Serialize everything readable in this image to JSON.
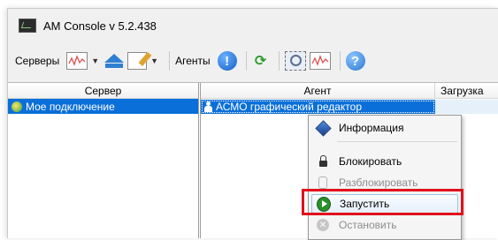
{
  "window": {
    "title": "AM Console v  5.2.438"
  },
  "toolbar": {
    "servers_label": "Серверы",
    "agents_label": "Агенты",
    "icons": [
      "monitor-chart-icon",
      "upload-arrow-icon",
      "edit-icon",
      "info-icon",
      "refresh-icon",
      "scan-icon",
      "monitor-chart-icon",
      "help-icon"
    ]
  },
  "left_pane": {
    "header": "Сервер",
    "rows": [
      {
        "label": "Мое подключение"
      }
    ]
  },
  "right_pane": {
    "headers": {
      "agent": "Агент",
      "load": "Загрузка"
    },
    "rows": [
      {
        "agent": "АСМО графический редактор",
        "load": ""
      }
    ]
  },
  "context_menu": {
    "items": [
      {
        "label": "Информация",
        "icon": "info-diamond-icon",
        "enabled": true
      },
      {
        "label": "Блокировать",
        "icon": "lock-icon",
        "enabled": true
      },
      {
        "label": "Разблокировать",
        "icon": "unlock-icon",
        "enabled": false
      },
      {
        "label": "Запустить",
        "icon": "play-icon",
        "enabled": true,
        "selected": true
      },
      {
        "label": "Остановить",
        "icon": "stop-icon",
        "enabled": false
      }
    ]
  },
  "colors": {
    "selection": "#0a6fd8",
    "highlight": "#e1101c"
  }
}
